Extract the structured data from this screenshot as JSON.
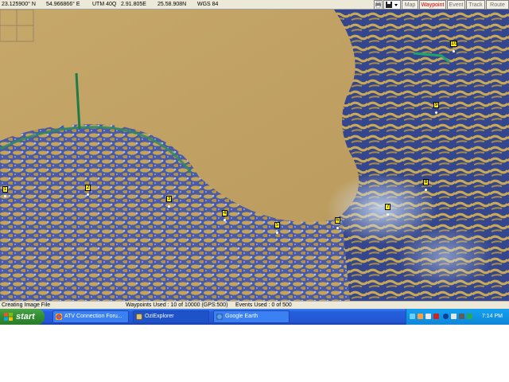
{
  "coords_bar": {
    "latitude": "23.125900° N",
    "longitude": "54.966866° E",
    "utm": "UTM  40Q",
    "easting": "2.91.805E",
    "northing": "25.58.908N",
    "datum": "WGS 84",
    "buttons": {
      "map": "Map",
      "waypoint": "Waypoint",
      "event": "Event",
      "track": "Track",
      "route": "Route"
    },
    "active_button": "waypoint"
  },
  "waypoints": [
    {
      "label": "1"
    },
    {
      "label": "2"
    },
    {
      "label": "3"
    },
    {
      "label": "4"
    },
    {
      "label": "5"
    },
    {
      "label": "6"
    },
    {
      "label": "7"
    },
    {
      "label": "8"
    },
    {
      "label": "9"
    },
    {
      "label": "10"
    }
  ],
  "status_bar": {
    "message": "Creating Image File",
    "waypoints_used": "Waypoints Used : 10 of 10000  (GPS:500)",
    "events_used": "Events Used : 0 of 500"
  },
  "taskbar": {
    "start_label": "start",
    "tasks": [
      {
        "label": "ATV Connection Foru...",
        "icon": "chrome-icon"
      },
      {
        "label": "OziExplorer",
        "icon": "oziexplorer-icon"
      },
      {
        "label": "Google Earth",
        "icon": "google-earth-icon"
      }
    ],
    "active_task": 1,
    "clock": "7:14 PM"
  },
  "colors": {
    "sand": "#c8a664",
    "dunes_blue": "#3e4f9c",
    "waypoint_marker": "#fff200",
    "active_button_text": "#d00000"
  }
}
